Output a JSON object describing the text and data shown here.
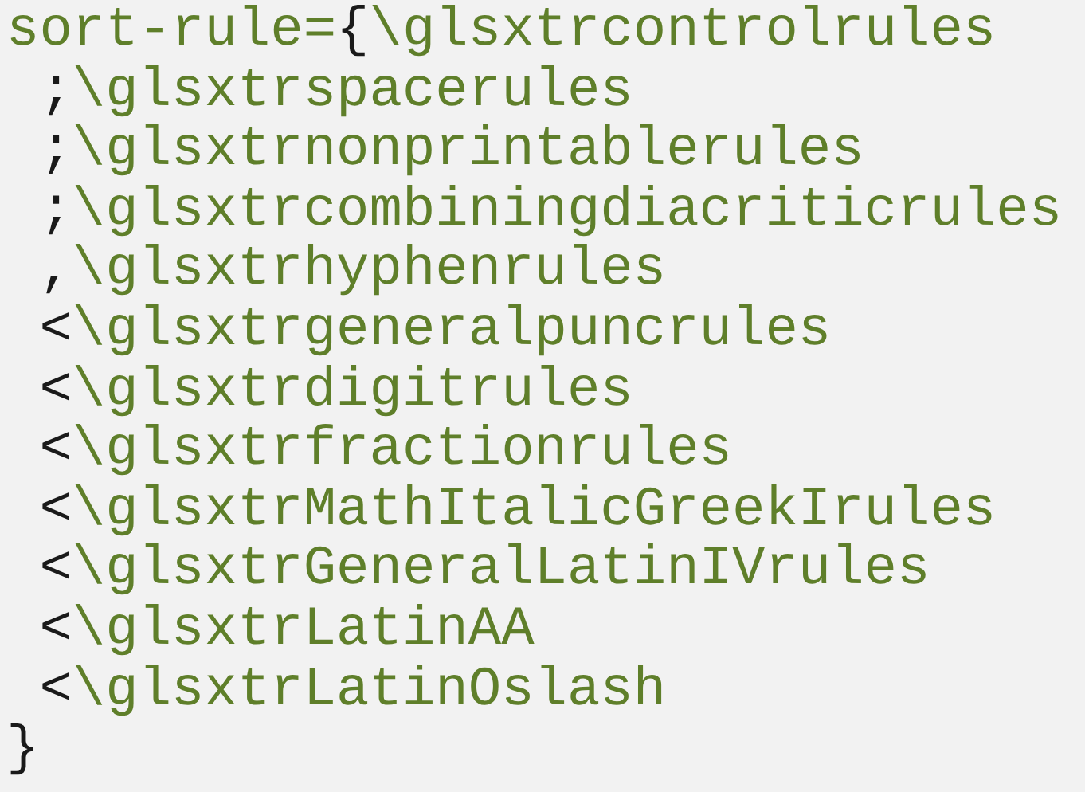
{
  "code_lines": [
    {
      "indented": false,
      "segments": [
        {
          "kind": "keyword",
          "text": "sort-rule="
        },
        {
          "kind": "punct",
          "text": "{"
        },
        {
          "kind": "keyword",
          "text": "\\glsxtrcontrolrules"
        }
      ]
    },
    {
      "indented": true,
      "segments": [
        {
          "kind": "punct",
          "text": ";"
        },
        {
          "kind": "keyword",
          "text": "\\glsxtrspacerules"
        }
      ]
    },
    {
      "indented": true,
      "segments": [
        {
          "kind": "punct",
          "text": ";"
        },
        {
          "kind": "keyword",
          "text": "\\glsxtrnonprintablerules"
        }
      ]
    },
    {
      "indented": true,
      "segments": [
        {
          "kind": "punct",
          "text": ";"
        },
        {
          "kind": "keyword",
          "text": "\\glsxtrcombiningdiacriticrules"
        }
      ]
    },
    {
      "indented": true,
      "segments": [
        {
          "kind": "punct",
          "text": ","
        },
        {
          "kind": "keyword",
          "text": "\\glsxtrhyphenrules"
        }
      ]
    },
    {
      "indented": true,
      "segments": [
        {
          "kind": "punct",
          "text": "<"
        },
        {
          "kind": "keyword",
          "text": "\\glsxtrgeneralpuncrules"
        }
      ]
    },
    {
      "indented": true,
      "segments": [
        {
          "kind": "punct",
          "text": "<"
        },
        {
          "kind": "keyword",
          "text": "\\glsxtrdigitrules"
        }
      ]
    },
    {
      "indented": true,
      "segments": [
        {
          "kind": "punct",
          "text": "<"
        },
        {
          "kind": "keyword",
          "text": "\\glsxtrfractionrules"
        }
      ]
    },
    {
      "indented": true,
      "segments": [
        {
          "kind": "punct",
          "text": "<"
        },
        {
          "kind": "keyword",
          "text": "\\glsxtrMathItalicGreekIrules"
        }
      ]
    },
    {
      "indented": true,
      "segments": [
        {
          "kind": "punct",
          "text": "<"
        },
        {
          "kind": "keyword",
          "text": "\\glsxtrGeneralLatinIVrules"
        }
      ]
    },
    {
      "indented": true,
      "segments": [
        {
          "kind": "punct",
          "text": "<"
        },
        {
          "kind": "keyword",
          "text": "\\glsxtrLatinAA"
        }
      ]
    },
    {
      "indented": true,
      "segments": [
        {
          "kind": "punct",
          "text": "<"
        },
        {
          "kind": "keyword",
          "text": "\\glsxtrLatinOslash"
        }
      ]
    },
    {
      "indented": false,
      "segments": [
        {
          "kind": "punct",
          "text": "}"
        }
      ]
    }
  ]
}
